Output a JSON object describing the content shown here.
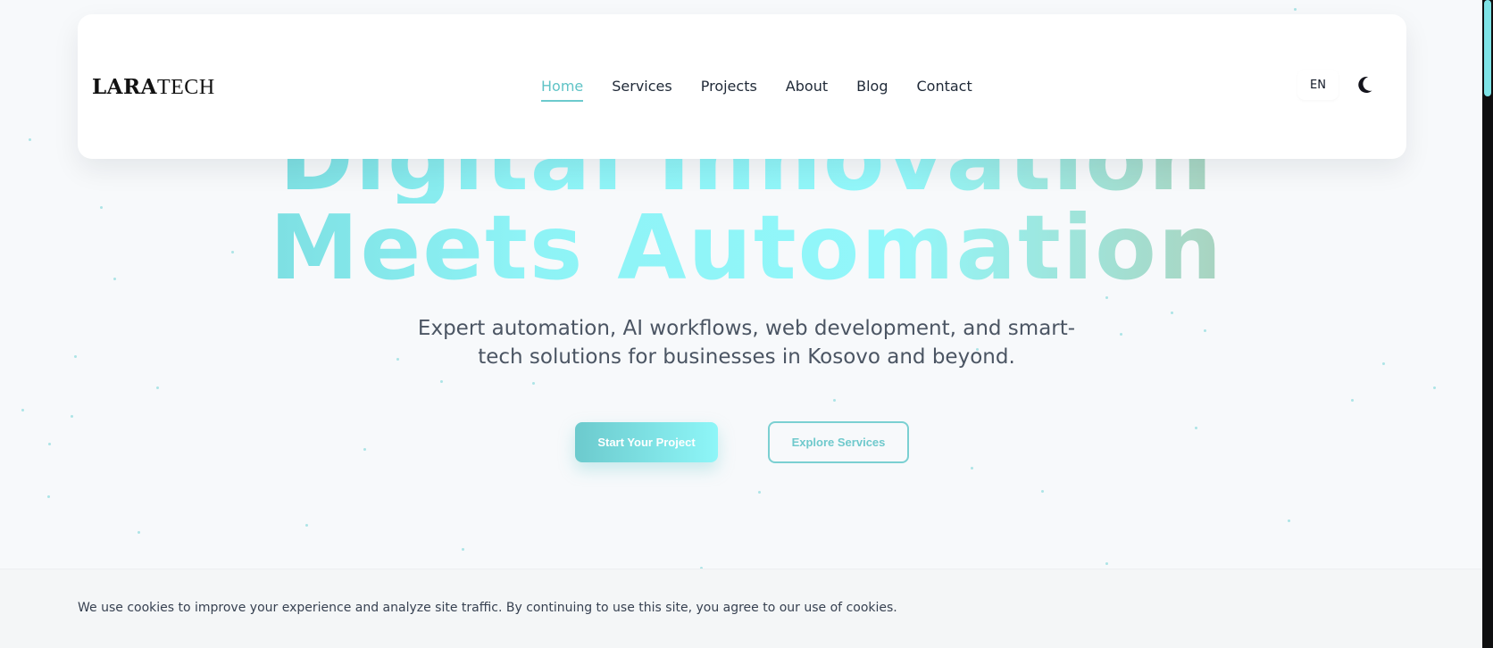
{
  "brand": {
    "logo_bold": "LARA",
    "logo_light": "TECH"
  },
  "nav": {
    "items": [
      {
        "label": "Home",
        "active": true
      },
      {
        "label": "Services",
        "active": false
      },
      {
        "label": "Projects",
        "active": false
      },
      {
        "label": "About",
        "active": false
      },
      {
        "label": "Blog",
        "active": false
      },
      {
        "label": "Contact",
        "active": false
      }
    ],
    "language": "EN",
    "theme_icon": "moon-icon"
  },
  "hero": {
    "title_line1": "Digital Innovation",
    "title_line2": "Meets Automation",
    "subtitle_line1": "Expert automation, AI workflows, web development, and smart-",
    "subtitle_line2": "tech solutions for businesses in Kosovo and beyond.",
    "primary_cta": "Start Your Project",
    "secondary_cta": "Explore Services"
  },
  "cookie_banner": {
    "text": "We use cookies to improve your experience and analyze site traffic. By continuing to use this site, you agree to our use of cookies."
  },
  "colors": {
    "accent": "#6ccacd",
    "accent_light": "#8ef6f8",
    "background": "#f7f9fb",
    "text": "#1f2937"
  }
}
